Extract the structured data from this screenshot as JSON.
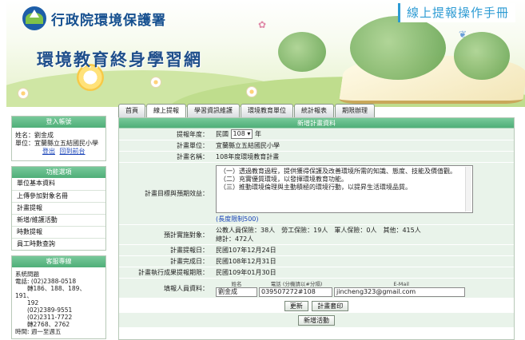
{
  "header": {
    "agency": "行政院環境保護署",
    "site_title": "環境教育終身學習網",
    "manual_link": "線上提報操作手冊"
  },
  "tabs": [
    {
      "label": "首頁"
    },
    {
      "label": "線上提報"
    },
    {
      "label": "學習資訊維護"
    },
    {
      "label": "環境教育單位"
    },
    {
      "label": "統計報表"
    },
    {
      "label": "期限辦理"
    }
  ],
  "sidebar": {
    "login": {
      "title": "登入帳號",
      "name_line": "姓名：劉金成",
      "unit_line": "單位：宜蘭縣立五結國民小學",
      "logout": "登出",
      "back_home": "回到前台"
    },
    "menu": {
      "title": "功能選項",
      "items": [
        "單位基本資料",
        "上傳參加對象名冊",
        "計畫提報",
        "新增/維護活動",
        "時數提報",
        "員工時數查詢"
      ]
    },
    "contact": {
      "title": "客服專線",
      "lines": [
        "系統問題",
        "電話: (02)2388-0518",
        "　　轉186、188、189、191、",
        "　　192",
        "　　(02)2389-9551",
        "　　(02)2311-7722",
        "　　轉2768、2762",
        "時間: 週一至週五"
      ]
    }
  },
  "form": {
    "title": "新增計畫資料",
    "year_label": "提報年度：",
    "year_prefix": "民國",
    "year_value": "108",
    "year_suffix": "年",
    "unit_label": "計畫單位：",
    "unit_value": "宜蘭縣立五結國民小學",
    "plan_name_label": "計畫名稱：",
    "plan_name_value": "108年度環境教育計畫",
    "goals_label": "計畫目標與預期效益：",
    "goals_text": "（一）透過教育過程，提供獲得保護及改善環境所需的知識、態度、技能及價值觀。\n（二）充實優質環境，以發揮環境教育功能。\n（三）推動環境倫理與主動積極的環境行動，以提昇生活環境品質。",
    "goals_hint": "(長度限制500)",
    "target_label": "預計實施對象：",
    "target_line1": "公教人員保險：38人　勞工保險：19人　軍人保險：0人　其他：415人",
    "target_line2": "總計：472人",
    "report_date_label": "計畫提報日：",
    "report_date_value": "民國107年12月24日",
    "finish_date_label": "計畫完成日：",
    "finish_date_value": "民國108年12月31日",
    "deadline_label": "計畫執行成果提報期限：",
    "deadline_value": "民國109年01月30日",
    "person_label": "填報人員資料：",
    "person_head_name": "姓名",
    "person_head_phone": "電話 (分機請以#分隔)",
    "person_head_email": "E-Mail",
    "person_name": "劉金成",
    "person_phone": "039507272#108",
    "person_email": "jincheng323@gmail.com",
    "update_button": "更新",
    "plan_print_button": "計畫套印",
    "add_activity_button": "新增活動"
  }
}
